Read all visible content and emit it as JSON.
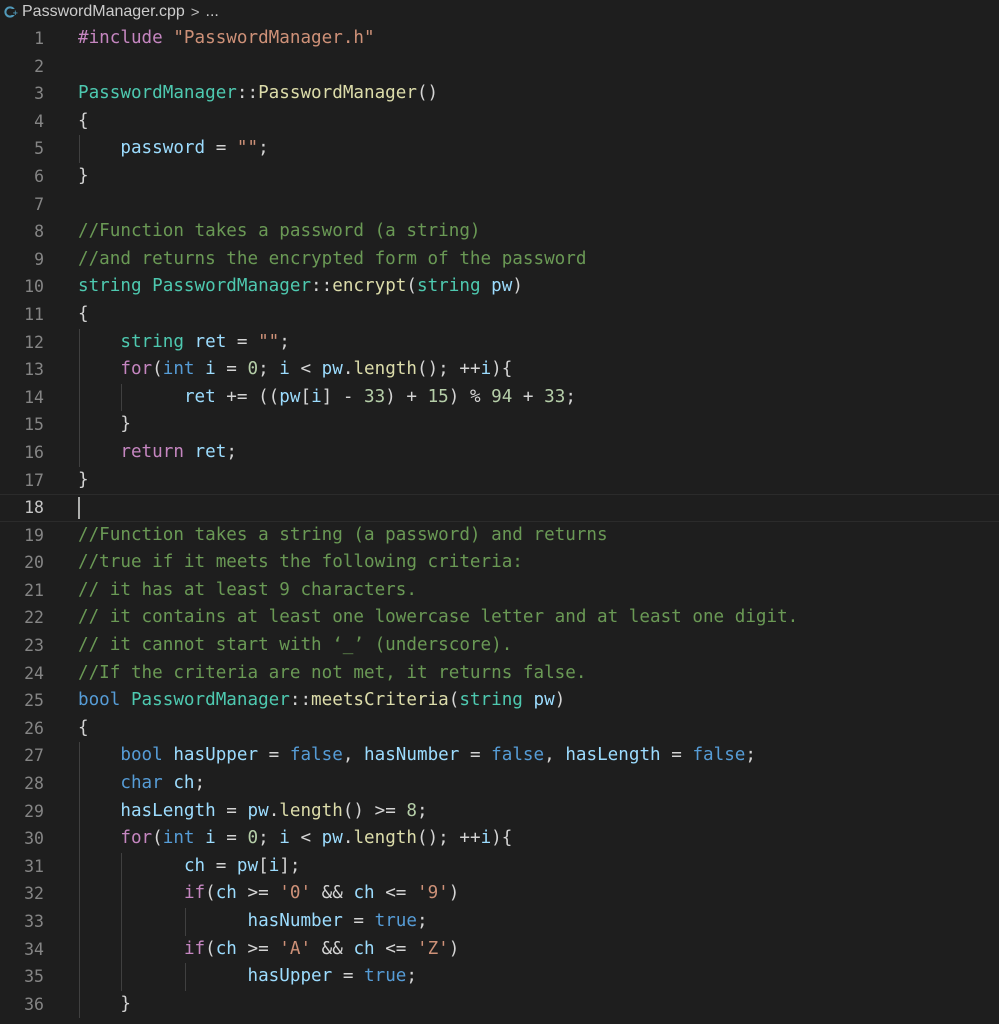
{
  "breadcrumb": {
    "file_name": "PasswordManager.cpp",
    "separator": ">",
    "ellipsis": "...",
    "file_icon": "cpp-file-icon"
  },
  "editor": {
    "current_line": 18,
    "colors": {
      "background": "#1e1e1e",
      "keyword": "#569cd6",
      "control": "#c586c0",
      "type": "#4ec9b0",
      "function": "#dcdcaa",
      "variable": "#9cdcfe",
      "string": "#ce9178",
      "number": "#b5cea8",
      "comment": "#6a9955",
      "line_number": "#858585"
    },
    "lines": [
      {
        "num": "1",
        "indent": 0,
        "tokens": [
          [
            "inc",
            "#include "
          ],
          [
            "str",
            "\"PasswordManager.h\""
          ]
        ]
      },
      {
        "num": "2",
        "indent": 0,
        "tokens": []
      },
      {
        "num": "3",
        "indent": 0,
        "tokens": [
          [
            "cls",
            "PasswordManager"
          ],
          [
            "pl",
            "::"
          ],
          [
            "fn",
            "PasswordManager"
          ],
          [
            "pl",
            "()"
          ]
        ]
      },
      {
        "num": "4",
        "indent": 0,
        "tokens": [
          [
            "pl",
            "{"
          ]
        ]
      },
      {
        "num": "5",
        "indent": 1,
        "tokens": [
          [
            "pl",
            "    "
          ],
          [
            "var",
            "password"
          ],
          [
            "pl",
            " = "
          ],
          [
            "str",
            "\"\""
          ],
          [
            "pl",
            ";"
          ]
        ]
      },
      {
        "num": "6",
        "indent": 0,
        "tokens": [
          [
            "pl",
            "}"
          ]
        ]
      },
      {
        "num": "7",
        "indent": 0,
        "tokens": []
      },
      {
        "num": "8",
        "indent": 0,
        "tokens": [
          [
            "cm",
            "//Function takes a password (a string)"
          ]
        ]
      },
      {
        "num": "9",
        "indent": 0,
        "tokens": [
          [
            "cm",
            "//and returns the encrypted form of the password"
          ]
        ]
      },
      {
        "num": "10",
        "indent": 0,
        "tokens": [
          [
            "cls",
            "string"
          ],
          [
            "pl",
            " "
          ],
          [
            "cls",
            "PasswordManager"
          ],
          [
            "pl",
            "::"
          ],
          [
            "fn",
            "encrypt"
          ],
          [
            "pl",
            "("
          ],
          [
            "cls",
            "string"
          ],
          [
            "pl",
            " "
          ],
          [
            "var",
            "pw"
          ],
          [
            "pl",
            ")"
          ]
        ]
      },
      {
        "num": "11",
        "indent": 0,
        "tokens": [
          [
            "pl",
            "{"
          ]
        ]
      },
      {
        "num": "12",
        "indent": 1,
        "tokens": [
          [
            "pl",
            "    "
          ],
          [
            "cls",
            "string"
          ],
          [
            "pl",
            " "
          ],
          [
            "var",
            "ret"
          ],
          [
            "pl",
            " = "
          ],
          [
            "str",
            "\"\""
          ],
          [
            "pl",
            ";"
          ]
        ]
      },
      {
        "num": "13",
        "indent": 1,
        "tokens": [
          [
            "pl",
            "    "
          ],
          [
            "ctl",
            "for"
          ],
          [
            "pl",
            "("
          ],
          [
            "kw",
            "int"
          ],
          [
            "pl",
            " "
          ],
          [
            "var",
            "i"
          ],
          [
            "pl",
            " = "
          ],
          [
            "num",
            "0"
          ],
          [
            "pl",
            "; "
          ],
          [
            "var",
            "i"
          ],
          [
            "pl",
            " < "
          ],
          [
            "var",
            "pw"
          ],
          [
            "pl",
            "."
          ],
          [
            "fn",
            "length"
          ],
          [
            "pl",
            "(); ++"
          ],
          [
            "var",
            "i"
          ],
          [
            "pl",
            "){"
          ]
        ]
      },
      {
        "num": "14",
        "indent": 2,
        "tokens": [
          [
            "pl",
            "          "
          ],
          [
            "var",
            "ret"
          ],
          [
            "pl",
            " += (("
          ],
          [
            "var",
            "pw"
          ],
          [
            "pl",
            "["
          ],
          [
            "var",
            "i"
          ],
          [
            "pl",
            "] - "
          ],
          [
            "num",
            "33"
          ],
          [
            "pl",
            ") + "
          ],
          [
            "num",
            "15"
          ],
          [
            "pl",
            ") % "
          ],
          [
            "num",
            "94"
          ],
          [
            "pl",
            " + "
          ],
          [
            "num",
            "33"
          ],
          [
            "pl",
            ";"
          ]
        ]
      },
      {
        "num": "15",
        "indent": 1,
        "tokens": [
          [
            "pl",
            "    }"
          ]
        ]
      },
      {
        "num": "16",
        "indent": 1,
        "tokens": [
          [
            "pl",
            "    "
          ],
          [
            "ctl",
            "return"
          ],
          [
            "pl",
            " "
          ],
          [
            "var",
            "ret"
          ],
          [
            "pl",
            ";"
          ]
        ]
      },
      {
        "num": "17",
        "indent": 0,
        "tokens": [
          [
            "pl",
            "}"
          ]
        ]
      },
      {
        "num": "18",
        "indent": 0,
        "tokens": []
      },
      {
        "num": "19",
        "indent": 0,
        "tokens": [
          [
            "cm",
            "//Function takes a string (a password) and returns"
          ]
        ]
      },
      {
        "num": "20",
        "indent": 0,
        "tokens": [
          [
            "cm",
            "//true if it meets the following criteria:"
          ]
        ]
      },
      {
        "num": "21",
        "indent": 0,
        "tokens": [
          [
            "cm",
            "// it has at least 9 characters."
          ]
        ]
      },
      {
        "num": "22",
        "indent": 0,
        "tokens": [
          [
            "cm",
            "// it contains at least one lowercase letter and at least one digit."
          ]
        ]
      },
      {
        "num": "23",
        "indent": 0,
        "tokens": [
          [
            "cm",
            "// it cannot start with ‘_’ (underscore)."
          ]
        ]
      },
      {
        "num": "24",
        "indent": 0,
        "tokens": [
          [
            "cm",
            "//If the criteria are not met, it returns false."
          ]
        ]
      },
      {
        "num": "25",
        "indent": 0,
        "tokens": [
          [
            "kw",
            "bool"
          ],
          [
            "pl",
            " "
          ],
          [
            "cls",
            "PasswordManager"
          ],
          [
            "pl",
            "::"
          ],
          [
            "fn",
            "meetsCriteria"
          ],
          [
            "pl",
            "("
          ],
          [
            "cls",
            "string"
          ],
          [
            "pl",
            " "
          ],
          [
            "var",
            "pw"
          ],
          [
            "pl",
            ")"
          ]
        ]
      },
      {
        "num": "26",
        "indent": 0,
        "tokens": [
          [
            "pl",
            "{"
          ]
        ]
      },
      {
        "num": "27",
        "indent": 1,
        "tokens": [
          [
            "pl",
            "    "
          ],
          [
            "kw",
            "bool"
          ],
          [
            "pl",
            " "
          ],
          [
            "var",
            "hasUpper"
          ],
          [
            "pl",
            " = "
          ],
          [
            "kw",
            "false"
          ],
          [
            "pl",
            ", "
          ],
          [
            "var",
            "hasNumber"
          ],
          [
            "pl",
            " = "
          ],
          [
            "kw",
            "false"
          ],
          [
            "pl",
            ", "
          ],
          [
            "var",
            "hasLength"
          ],
          [
            "pl",
            " = "
          ],
          [
            "kw",
            "false"
          ],
          [
            "pl",
            ";"
          ]
        ]
      },
      {
        "num": "28",
        "indent": 1,
        "tokens": [
          [
            "pl",
            "    "
          ],
          [
            "kw",
            "char"
          ],
          [
            "pl",
            " "
          ],
          [
            "var",
            "ch"
          ],
          [
            "pl",
            ";"
          ]
        ]
      },
      {
        "num": "29",
        "indent": 1,
        "tokens": [
          [
            "pl",
            "    "
          ],
          [
            "var",
            "hasLength"
          ],
          [
            "pl",
            " = "
          ],
          [
            "var",
            "pw"
          ],
          [
            "pl",
            "."
          ],
          [
            "fn",
            "length"
          ],
          [
            "pl",
            "() >= "
          ],
          [
            "num",
            "8"
          ],
          [
            "pl",
            ";"
          ]
        ]
      },
      {
        "num": "30",
        "indent": 1,
        "tokens": [
          [
            "pl",
            "    "
          ],
          [
            "ctl",
            "for"
          ],
          [
            "pl",
            "("
          ],
          [
            "kw",
            "int"
          ],
          [
            "pl",
            " "
          ],
          [
            "var",
            "i"
          ],
          [
            "pl",
            " = "
          ],
          [
            "num",
            "0"
          ],
          [
            "pl",
            "; "
          ],
          [
            "var",
            "i"
          ],
          [
            "pl",
            " < "
          ],
          [
            "var",
            "pw"
          ],
          [
            "pl",
            "."
          ],
          [
            "fn",
            "length"
          ],
          [
            "pl",
            "(); ++"
          ],
          [
            "var",
            "i"
          ],
          [
            "pl",
            "){"
          ]
        ]
      },
      {
        "num": "31",
        "indent": 2,
        "tokens": [
          [
            "pl",
            "          "
          ],
          [
            "var",
            "ch"
          ],
          [
            "pl",
            " = "
          ],
          [
            "var",
            "pw"
          ],
          [
            "pl",
            "["
          ],
          [
            "var",
            "i"
          ],
          [
            "pl",
            "];"
          ]
        ]
      },
      {
        "num": "32",
        "indent": 2,
        "tokens": [
          [
            "pl",
            "          "
          ],
          [
            "ctl",
            "if"
          ],
          [
            "pl",
            "("
          ],
          [
            "var",
            "ch"
          ],
          [
            "pl",
            " >= "
          ],
          [
            "str",
            "'0'"
          ],
          [
            "pl",
            " && "
          ],
          [
            "var",
            "ch"
          ],
          [
            "pl",
            " <= "
          ],
          [
            "str",
            "'9'"
          ],
          [
            "pl",
            ")"
          ]
        ]
      },
      {
        "num": "33",
        "indent": 3,
        "tokens": [
          [
            "pl",
            "                "
          ],
          [
            "var",
            "hasNumber"
          ],
          [
            "pl",
            " = "
          ],
          [
            "kw",
            "true"
          ],
          [
            "pl",
            ";"
          ]
        ]
      },
      {
        "num": "34",
        "indent": 2,
        "tokens": [
          [
            "pl",
            "          "
          ],
          [
            "ctl",
            "if"
          ],
          [
            "pl",
            "("
          ],
          [
            "var",
            "ch"
          ],
          [
            "pl",
            " >= "
          ],
          [
            "str",
            "'A'"
          ],
          [
            "pl",
            " && "
          ],
          [
            "var",
            "ch"
          ],
          [
            "pl",
            " <= "
          ],
          [
            "str",
            "'Z'"
          ],
          [
            "pl",
            ")"
          ]
        ]
      },
      {
        "num": "35",
        "indent": 3,
        "tokens": [
          [
            "pl",
            "                "
          ],
          [
            "var",
            "hasUpper"
          ],
          [
            "pl",
            " = "
          ],
          [
            "kw",
            "true"
          ],
          [
            "pl",
            ";"
          ]
        ]
      },
      {
        "num": "36",
        "indent": 1,
        "tokens": [
          [
            "pl",
            "    }"
          ]
        ]
      }
    ]
  }
}
